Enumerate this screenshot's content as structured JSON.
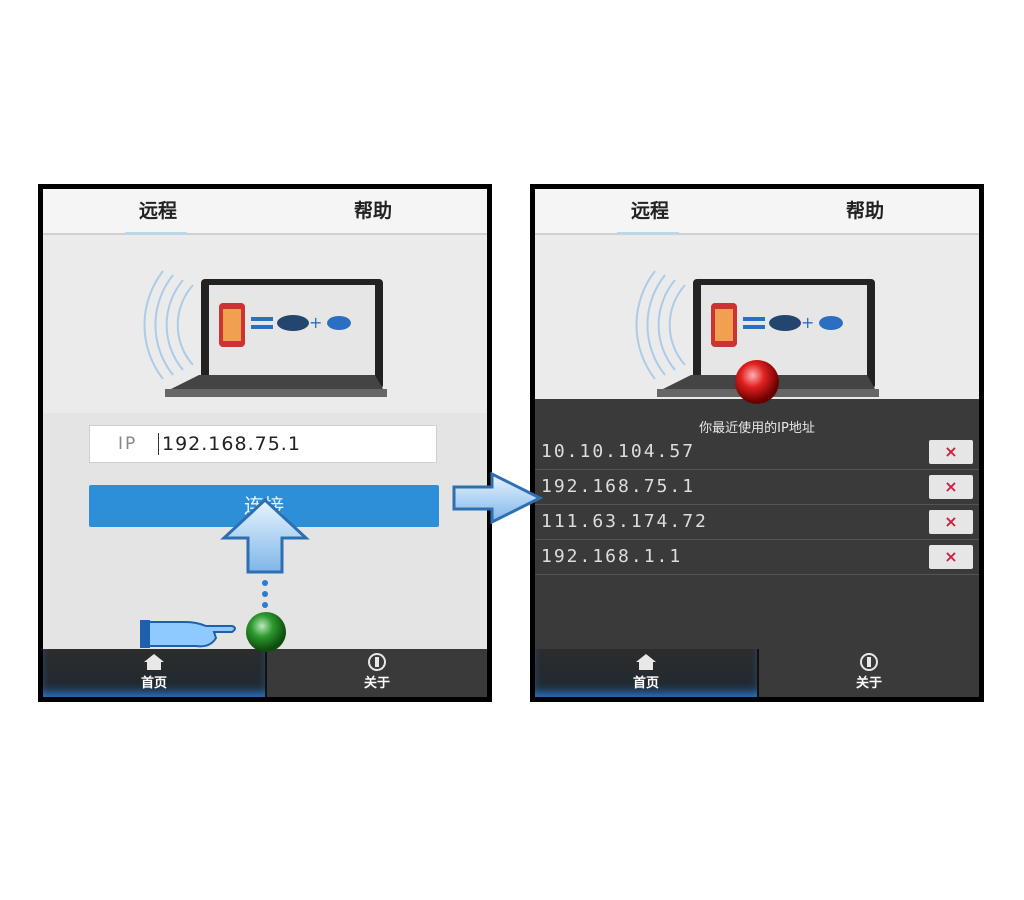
{
  "tabs": {
    "remote": "远程",
    "help": "帮助"
  },
  "ip_input": {
    "label": "IP",
    "value": "192.168.75.1"
  },
  "connect_button": "连接",
  "bottom_tabs": {
    "home": "首页",
    "about": "关于"
  },
  "recent": {
    "title": "你最近使用的IP地址",
    "delete_symbol": "×",
    "items": [
      "10.10.104.57",
      "192.168.75.1",
      "111.63.174.72",
      "192.168.1.1"
    ]
  },
  "colors": {
    "accent": "#2d8fd8",
    "delete_x": "#d02040",
    "panel_dark": "#3a3a3a"
  }
}
